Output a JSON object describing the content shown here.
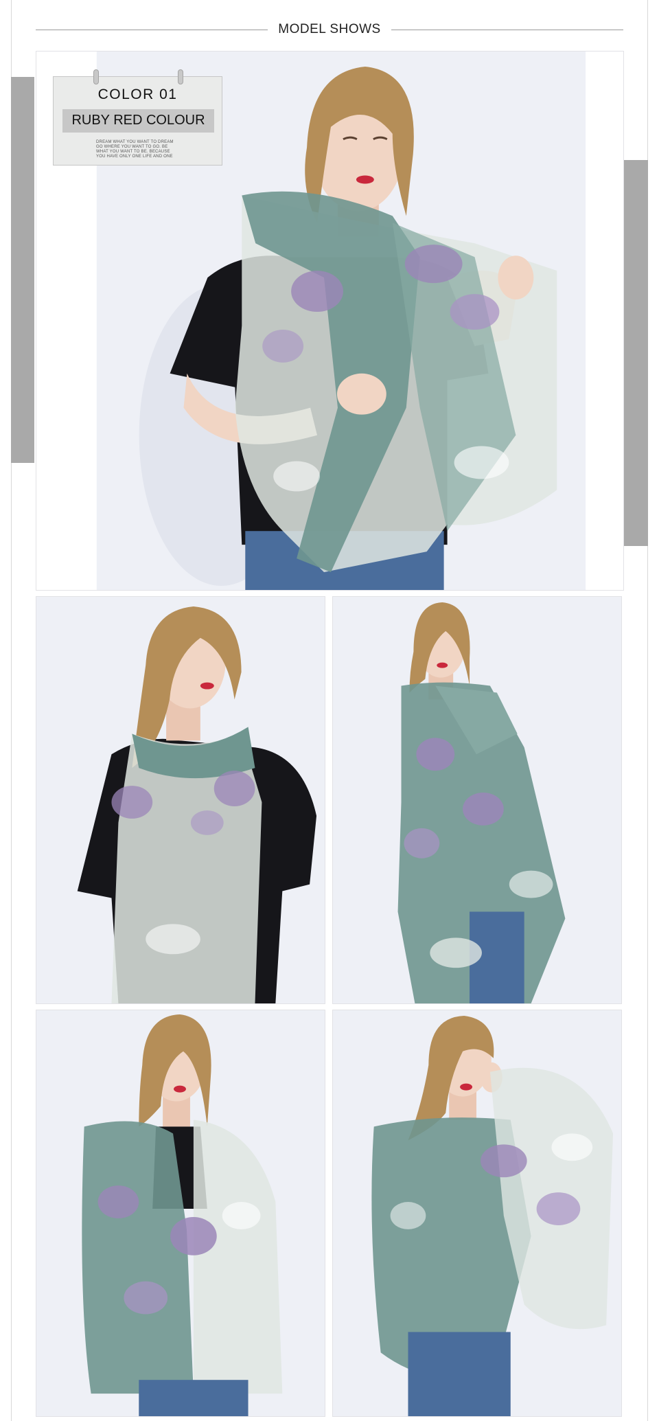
{
  "header": {
    "title": "MODEL SHOWS"
  },
  "color_card": {
    "code": "COLOR 01",
    "name": "RUBY RED COLOUR",
    "tagline": [
      "DREAM WHAT YOU WANT TO DREAM",
      "GO WHERE YOU WANT TO GO. BE",
      "WHAT YOU WANT TO BE. BECAUSE",
      "YOU HAVE ONLY ONE LIFE AND ONE"
    ]
  },
  "palette": {
    "scarf_green": "#6f9690",
    "scarf_light": "#dfe6e2",
    "flower_purple": "#9b86b8",
    "hair": "#b58e58",
    "skin": "#f1d5c4",
    "top_black": "#16161a",
    "jeans": "#4a6d9c",
    "backdrop": "#eef0f6",
    "band_gray": "#a9a9a9"
  }
}
